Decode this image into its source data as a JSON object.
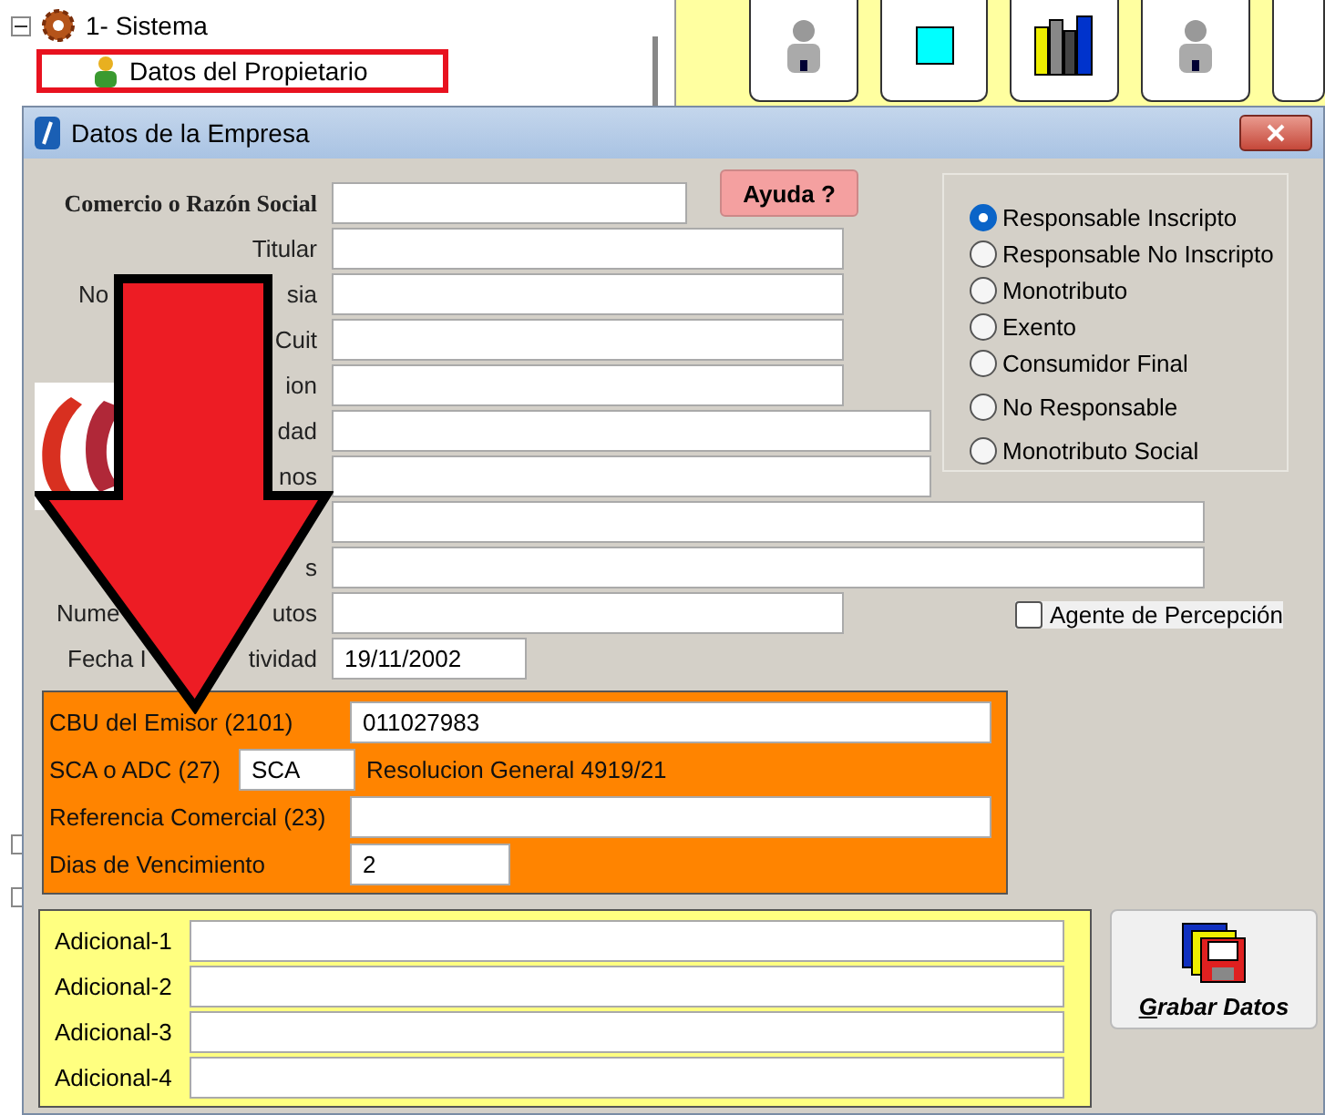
{
  "tree": {
    "items": [
      {
        "label": "1- Sistema",
        "expanded": true,
        "children": [
          {
            "label": "Datos del Propietario",
            "highlighted": true
          }
        ]
      }
    ]
  },
  "dialog": {
    "title": "Datos de la Empresa",
    "help_button": "Ayuda ?",
    "fields": [
      {
        "kind": "text",
        "label_parts": [
          "Comercio o Razón Social"
        ]
      },
      {
        "kind": "text",
        "label_parts": [
          "Titular"
        ]
      },
      {
        "kind": "text",
        "label_parts": [
          "No",
          "sia"
        ]
      },
      {
        "kind": "text",
        "label_parts": [
          "Cuit"
        ]
      },
      {
        "kind": "text",
        "label_parts": [
          "ion"
        ]
      },
      {
        "kind": "text",
        "label_parts": [
          "dad"
        ]
      },
      {
        "kind": "text",
        "label_parts": [
          "nos"
        ]
      },
      {
        "kind": "text"
      },
      {
        "kind": "text",
        "label_parts": [
          "s"
        ]
      },
      {
        "kind": "text",
        "label_parts": [
          "Nume",
          "utos"
        ]
      },
      {
        "kind": "date",
        "label_parts": [
          "Fecha I",
          "tividad"
        ],
        "value": "19/11/2002"
      }
    ],
    "tax_options": [
      {
        "label": "Responsable Inscripto",
        "selected": true
      },
      {
        "label": "Responsable No Inscripto",
        "selected": false
      },
      {
        "label": "Monotributo",
        "selected": false
      },
      {
        "label": "Exento",
        "selected": false
      },
      {
        "label": "Consumidor Final",
        "selected": false
      },
      {
        "label": "No Responsable",
        "selected": false
      },
      {
        "label": "Monotributo Social",
        "selected": false
      }
    ],
    "agent_checkbox": {
      "label": "Agente de Percepción",
      "checked": false
    },
    "billing": {
      "cbu": {
        "label": "CBU del Emisor (2101)",
        "value": "011027983"
      },
      "sca": {
        "label": "SCA o ADC (27)",
        "value": "SCA",
        "note": "Resolucion General 4919/21"
      },
      "reference": {
        "label": "Referencia Comercial (23)"
      },
      "due_days": {
        "label": "Dias de Vencimiento",
        "value": "2"
      }
    },
    "additional": [
      {
        "label": "Adicional-1"
      },
      {
        "label": "Adicional-2"
      },
      {
        "label": "Adicional-3"
      },
      {
        "label": "Adicional-4"
      }
    ],
    "save_button": "Grabar Datos"
  }
}
